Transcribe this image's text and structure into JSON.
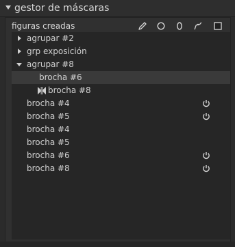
{
  "module": {
    "title": "gestor de máscaras"
  },
  "toolbar": {
    "label": "figuras creadas",
    "tools": [
      {
        "name": "pencil-icon"
      },
      {
        "name": "circle-icon"
      },
      {
        "name": "ellipse-icon"
      },
      {
        "name": "path-icon"
      },
      {
        "name": "square-icon"
      }
    ]
  },
  "tree": {
    "rows": [
      {
        "label": "agrupar #2",
        "expander": "collapsed"
      },
      {
        "label": "grp exposición",
        "expander": "collapsed"
      },
      {
        "label": "agrupar #8",
        "expander": "expanded"
      },
      {
        "label": "brocha #6",
        "selected": true
      },
      {
        "label": "brocha #8",
        "icon": "bowtie-icon"
      },
      {
        "label": "brocha #4",
        "power": true
      },
      {
        "label": "brocha #5",
        "power": true
      },
      {
        "label": "brocha #4"
      },
      {
        "label": "brocha #5"
      },
      {
        "label": "brocha #6",
        "power": true
      },
      {
        "label": "brocha #8",
        "power": true
      }
    ]
  },
  "colors": {
    "background": "#2b2b2b",
    "panel": "#303030",
    "tree_background": "#262626",
    "selected_row": "#3a3a3a",
    "text": "#d2d2d2"
  }
}
